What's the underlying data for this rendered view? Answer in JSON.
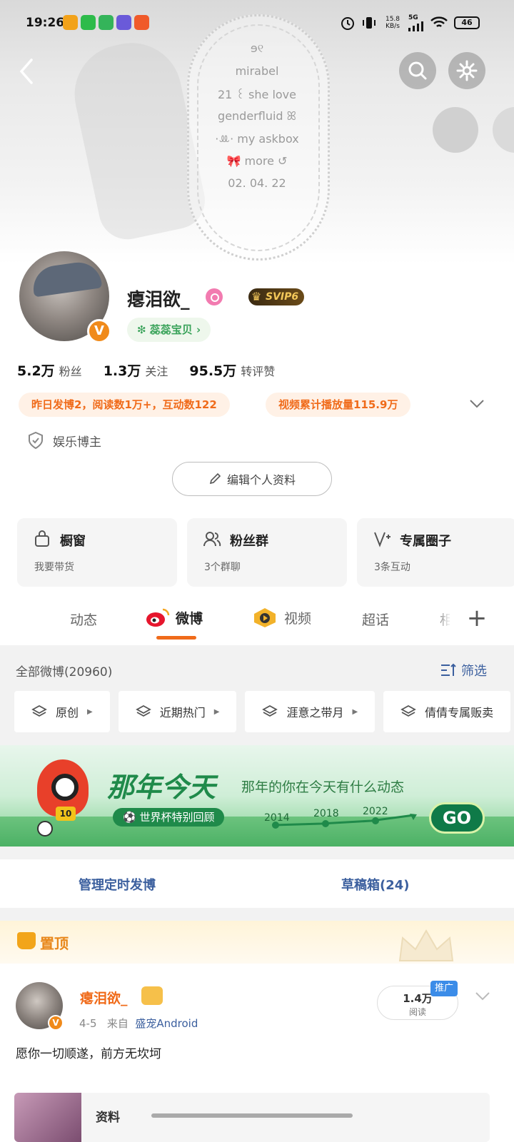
{
  "status_bar": {
    "time": "19:26",
    "net_speed": "15.8\nKB/s",
    "net_speed_value": "15.8",
    "net_speed_unit": "KB/s",
    "network": "5G",
    "battery": "46"
  },
  "cover": {
    "bio_lines": [
      "ɘ୧",
      "mirabel",
      "21  ꒰ she love",
      "genderfluid  ꕤ",
      "·ꔛ·  my askbox",
      "🎀  more ↺",
      "02.  04.  22"
    ]
  },
  "profile": {
    "username": "瘪泪欲_",
    "vip_label": "SVIP6",
    "fan_tag": "❇ 蕊蕊宝贝 ›",
    "verify_badge": "V",
    "stats": [
      {
        "value": "5.2万",
        "label": "粉丝"
      },
      {
        "value": "1.3万",
        "label": "关注"
      },
      {
        "value": "95.5万",
        "label": "转评赞"
      }
    ],
    "highlights": [
      "昨日发博2，阅读数1万+，互动数122",
      "视频累计播放量115.9万"
    ],
    "category": "娱乐博主",
    "edit_button": "编辑个人资料"
  },
  "cards": [
    {
      "title": "橱窗",
      "sub": "我要带货",
      "icon": "bag-icon"
    },
    {
      "title": "粉丝群",
      "sub": "3个群聊",
      "icon": "group-icon"
    },
    {
      "title": "专属圈子",
      "sub": "3条互动",
      "icon": "circle-icon"
    }
  ],
  "tabs": [
    "动态",
    "微博",
    "视频",
    "超话",
    "相"
  ],
  "feed": {
    "all_label": "全部微博(20960)",
    "filter_label": "筛选",
    "chips": [
      "原创",
      "近期热门",
      "涯意之带月",
      "倩倩专属贩卖"
    ]
  },
  "banner": {
    "title": "那年今天",
    "subtitle": "那年的你在今天有什么动态",
    "badge": "⚽ 世界杯特别回顾",
    "years": [
      "2014",
      "2018",
      "2022"
    ],
    "go": "GO",
    "mascot_number": "10"
  },
  "manage": {
    "scheduled": "管理定时发博",
    "drafts": "草稿箱(24)"
  },
  "pinned": {
    "label": "置顶",
    "author": "瘪泪欲_",
    "date": "4-5",
    "from_prefix": "来自",
    "source": "盛宠Android",
    "reads": "1.4万",
    "reads_label": "阅读",
    "promo": "推广",
    "text": "愿你一切顺遂，前方无坎坷",
    "media_title": "资料"
  },
  "colors": {
    "accent": "#f06b1a",
    "link": "#3b5f9e",
    "verify": "#f08a1a"
  }
}
